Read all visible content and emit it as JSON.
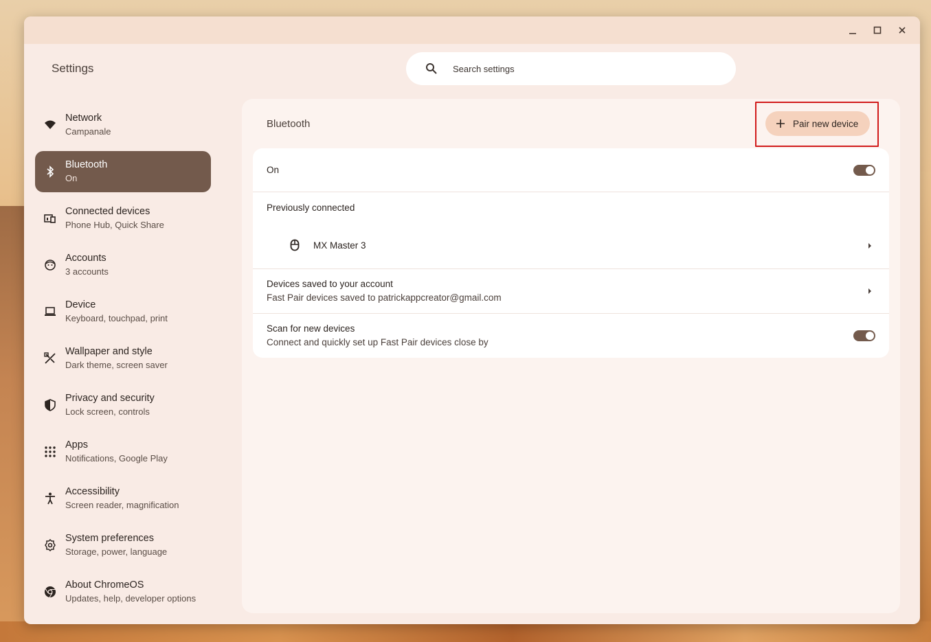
{
  "app": {
    "title": "Settings"
  },
  "search": {
    "placeholder": "Search settings"
  },
  "sidebar": {
    "items": [
      {
        "label": "Network",
        "sub": "Campanale",
        "icon": "wifi-icon"
      },
      {
        "label": "Bluetooth",
        "sub": "On",
        "icon": "bluetooth-icon",
        "active": true
      },
      {
        "label": "Connected devices",
        "sub": "Phone Hub, Quick Share",
        "icon": "devices-icon"
      },
      {
        "label": "Accounts",
        "sub": "3 accounts",
        "icon": "face-icon"
      },
      {
        "label": "Device",
        "sub": "Keyboard, touchpad, print",
        "icon": "laptop-icon"
      },
      {
        "label": "Wallpaper and style",
        "sub": "Dark theme, screen saver",
        "icon": "palette-icon"
      },
      {
        "label": "Privacy and security",
        "sub": "Lock screen, controls",
        "icon": "shield-icon"
      },
      {
        "label": "Apps",
        "sub": "Notifications, Google Play",
        "icon": "apps-grid-icon"
      },
      {
        "label": "Accessibility",
        "sub": "Screen reader, magnification",
        "icon": "accessibility-icon"
      },
      {
        "label": "System preferences",
        "sub": "Storage, power, language",
        "icon": "gear-icon"
      },
      {
        "label": "About ChromeOS",
        "sub": "Updates, help, developer options",
        "icon": "chrome-icon"
      }
    ]
  },
  "main": {
    "title": "Bluetooth",
    "pair_button": "Pair new device",
    "on_row": {
      "label": "On",
      "toggle": true
    },
    "previously_connected": {
      "heading": "Previously connected",
      "devices": [
        {
          "name": "MX Master 3",
          "icon": "mouse-icon"
        }
      ]
    },
    "saved_devices": {
      "title": "Devices saved to your account",
      "sub": "Fast Pair devices saved to patrickappcreator@gmail.com"
    },
    "scan": {
      "title": "Scan for new devices",
      "sub": "Connect and quickly set up Fast Pair devices close by",
      "toggle": true
    }
  },
  "colors": {
    "accent": "#735a4c",
    "pair_button_bg": "#f5d2bd",
    "highlight_box": "#d11a1a",
    "window_bg": "#f9ebe5"
  }
}
